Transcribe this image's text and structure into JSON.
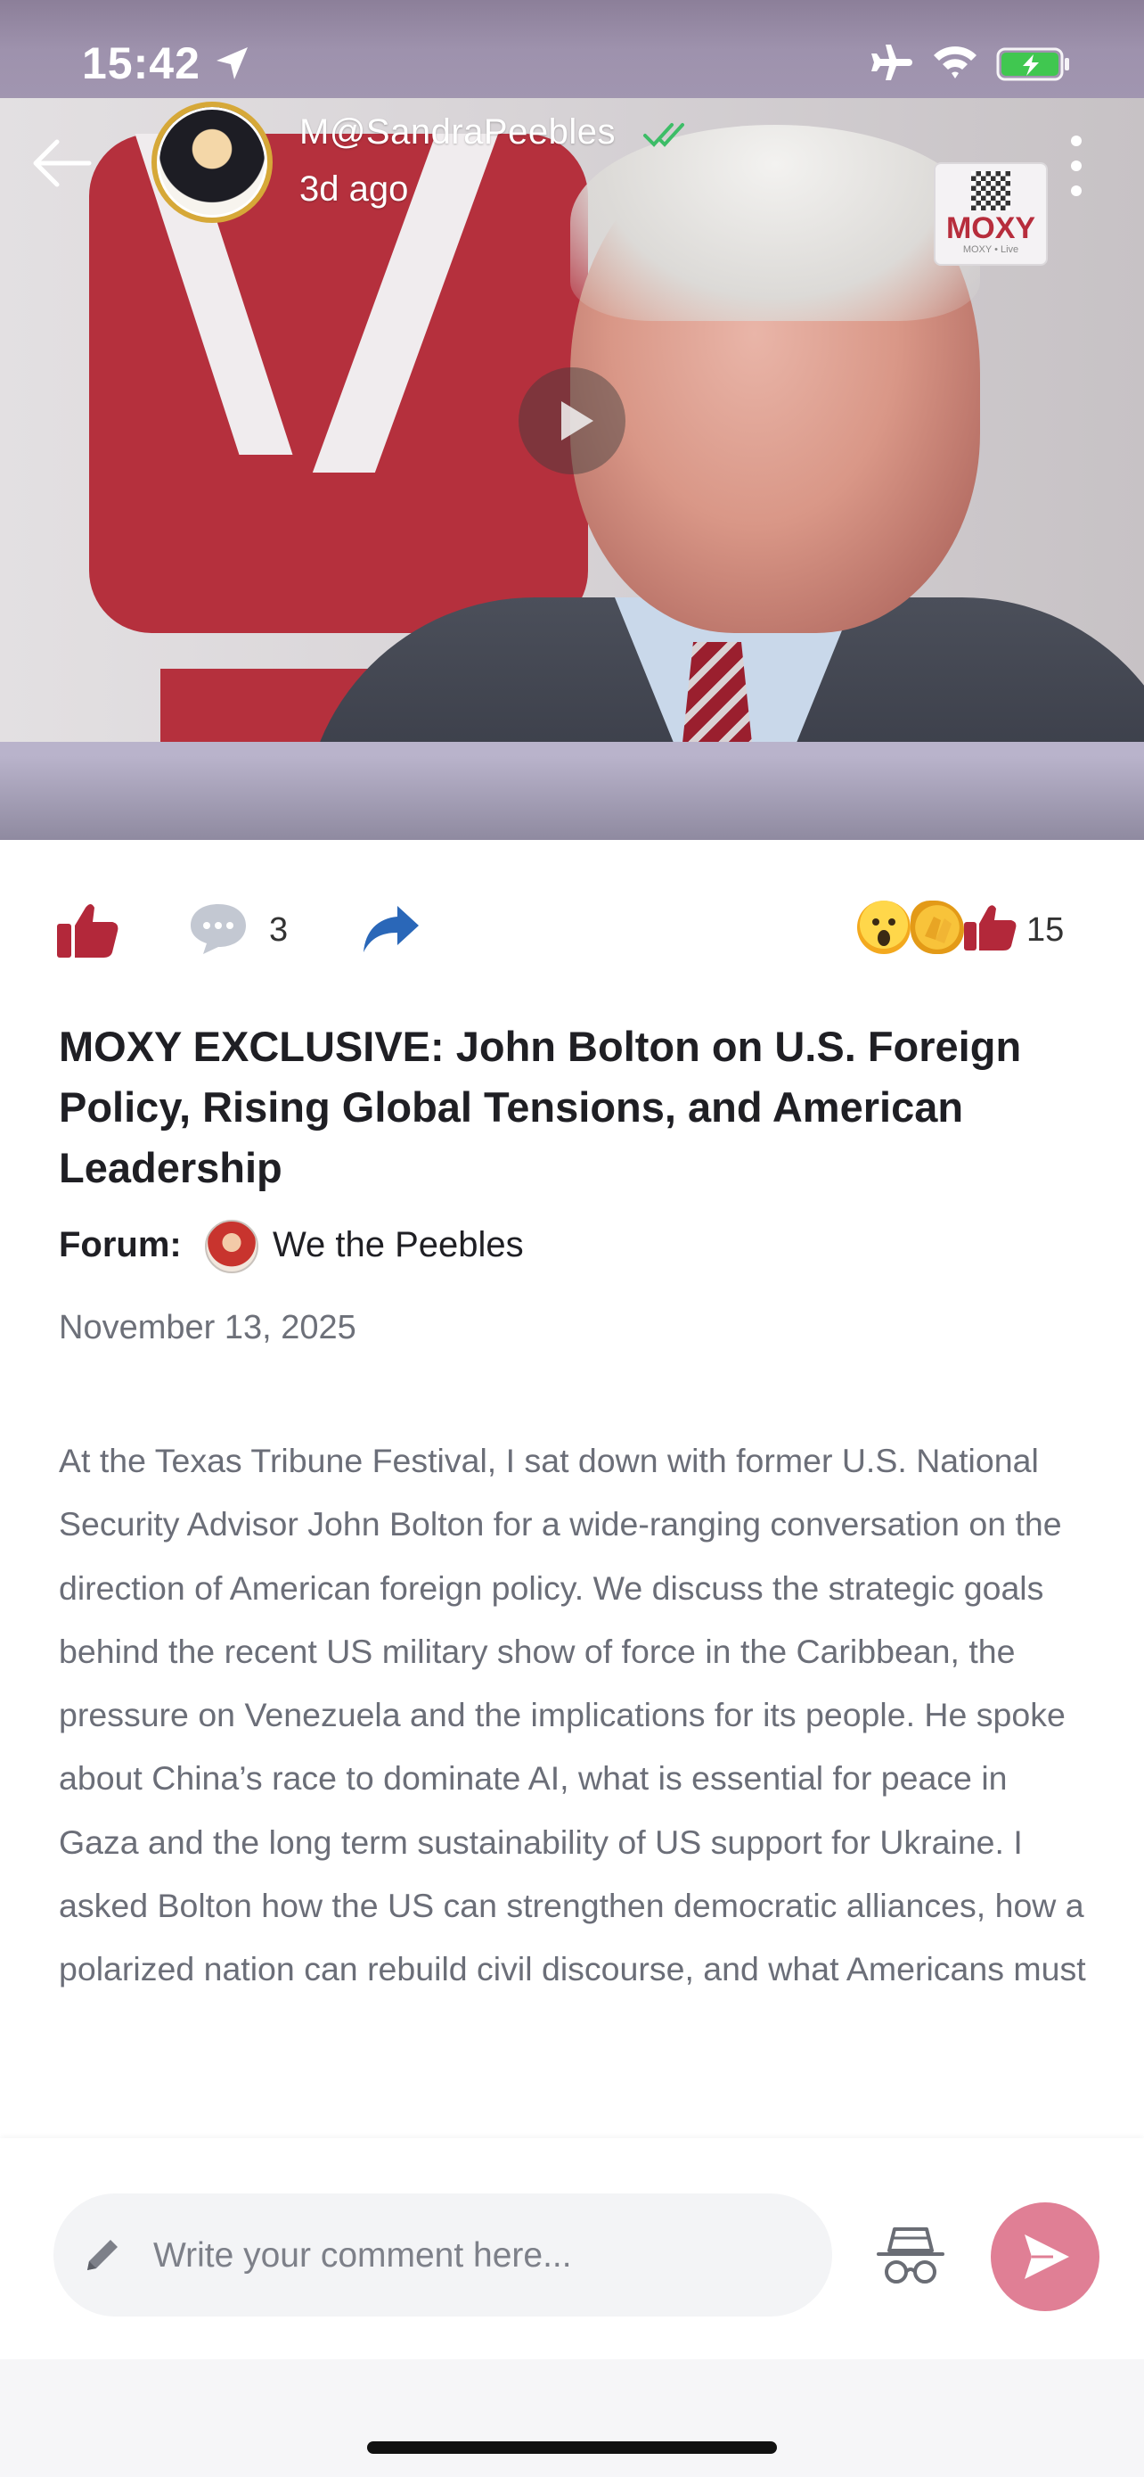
{
  "status_bar": {
    "time": "15:42",
    "icons": [
      "location-arrow-icon",
      "airplane-icon",
      "wifi-icon",
      "battery-charging-icon"
    ]
  },
  "header": {
    "author_name": "M@SandraPeebles",
    "post_time": "3d ago",
    "badge_text": "MOXY",
    "badge_subtext": "MOXY • Live",
    "verified_icon": "double-check-icon",
    "back_icon": "back-arrow-icon",
    "more_icon": "more-vertical-icon"
  },
  "video": {
    "play_icon": "play-icon"
  },
  "actions": {
    "comment_count": "3",
    "reaction_count": "15",
    "reactions": [
      "wow-emoji",
      "clap-emoji",
      "thumbs-up-emoji"
    ]
  },
  "post": {
    "title": "MOXY EXCLUSIVE: John Bolton on U.S. Foreign Policy, Rising Global Tensions, and American Leadership",
    "forum_label": "Forum:",
    "forum_name": "We the Peebles",
    "date": "November 13, 2025",
    "body": "At the Texas Tribune Festival, I sat down with former U.S. National Security Advisor John Bolton for a wide-ranging conversation on the direction of American foreign policy. We discuss the strategic goals behind the recent US military show of force in the Caribbean,  the pressure on Venezuela and the implications for its people. He spoke about China’s race to dominate AI, what is essential for peace in Gaza and the long term sustainability of US support for Ukraine.  I asked Bolton how the US can strengthen democratic alliances, how a polarized nation can rebuild civil discourse, and what Americans must"
  },
  "comment_bar": {
    "placeholder": "Write your comment here..."
  },
  "colors": {
    "accent_red": "#b3283a",
    "send_pink": "#e07f95",
    "share_blue": "#2a67b8",
    "verified_green": "#3dbd67",
    "body_gray": "#6b6e78"
  }
}
